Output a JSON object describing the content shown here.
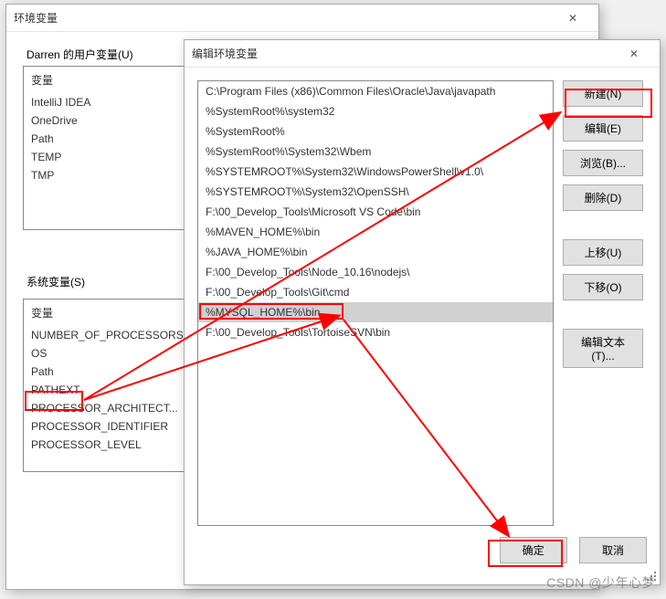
{
  "env_dialog": {
    "title": "环境变量",
    "user_group": "Darren 的用户变量(U)",
    "sys_group": "系统变量(S)",
    "col_var": "变量",
    "user_vars": [
      "IntelliJ IDEA",
      "OneDrive",
      "Path",
      "TEMP",
      "TMP"
    ],
    "sys_vars": [
      "NUMBER_OF_PROCESSORS",
      "OS",
      "Path",
      "PATHEXT",
      "PROCESSOR_ARCHITECT...",
      "PROCESSOR_IDENTIFIER",
      "PROCESSOR_LEVEL"
    ],
    "ok": "确定",
    "cancel": "取消"
  },
  "edit_dialog": {
    "title": "编辑环境变量",
    "paths": [
      "C:\\Program Files (x86)\\Common Files\\Oracle\\Java\\javapath",
      "%SystemRoot%\\system32",
      "%SystemRoot%",
      "%SystemRoot%\\System32\\Wbem",
      "%SYSTEMROOT%\\System32\\WindowsPowerShell\\v1.0\\",
      "%SYSTEMROOT%\\System32\\OpenSSH\\",
      "F:\\00_Develop_Tools\\Microsoft VS Code\\bin",
      "%MAVEN_HOME%\\bin",
      "%JAVA_HOME%\\bin",
      "F:\\00_Develop_Tools\\Node_10.16\\nodejs\\",
      "F:\\00_Develop_Tools\\Git\\cmd",
      "%MYSQL_HOME%\\bin",
      "F:\\00_Develop_Tools\\TortoiseSVN\\bin"
    ],
    "selected_index": 11,
    "btn_new": "新建(N)",
    "btn_edit": "编辑(E)",
    "btn_browse": "浏览(B)...",
    "btn_delete": "删除(D)",
    "btn_up": "上移(U)",
    "btn_down": "下移(O)",
    "btn_edittext": "编辑文本(T)...",
    "ok": "确定",
    "cancel": "取消"
  },
  "watermark": "CSDN @少年心梦"
}
